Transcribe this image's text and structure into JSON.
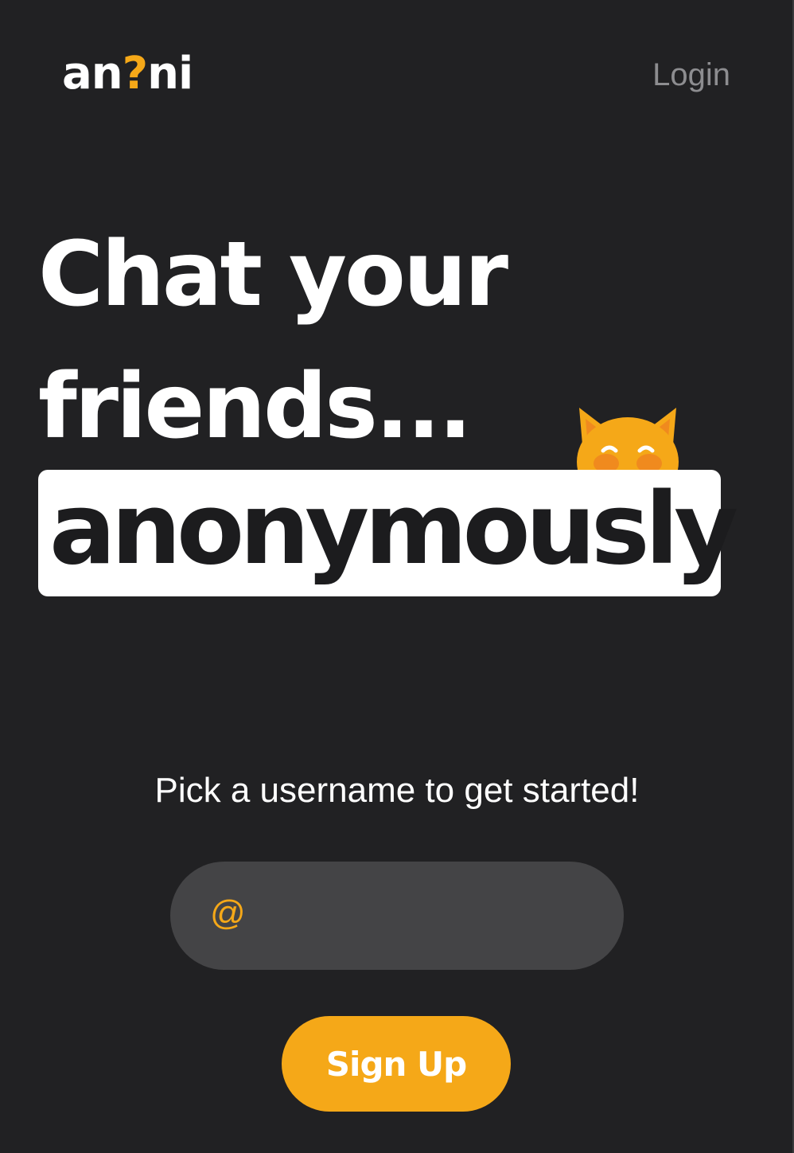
{
  "header": {
    "logo": {
      "part1": "an",
      "part2": "?",
      "part3": "ni"
    },
    "login_label": "Login"
  },
  "hero": {
    "line1": "Chat your",
    "line2": "friends...",
    "highlight": "anonymously"
  },
  "signup": {
    "prompt": "Pick a username to get started!",
    "at_symbol": "@",
    "username_value": "",
    "button_label": "Sign Up"
  },
  "icons": {
    "mascot": "cat-face-icon"
  },
  "colors": {
    "background": "#212123",
    "accent": "#F5A818",
    "input_bg": "#444446",
    "login_text": "#8d8d90"
  }
}
